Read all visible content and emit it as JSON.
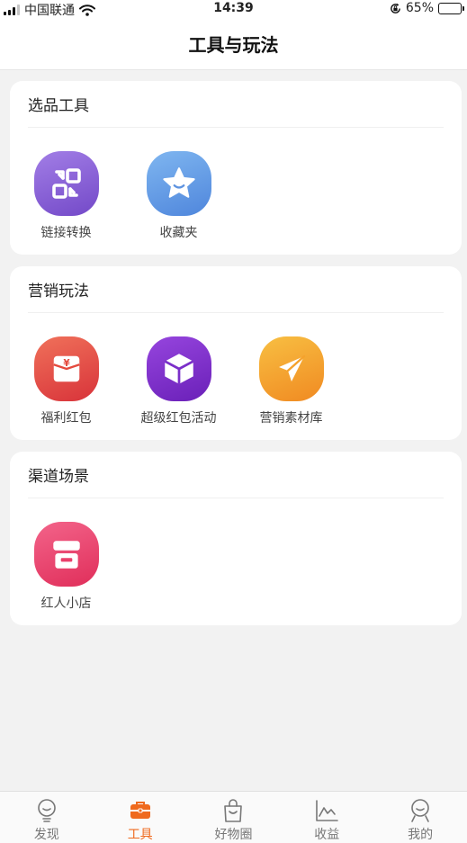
{
  "status_bar": {
    "carrier": "中国联通",
    "time": "14:39",
    "battery": "65%",
    "battery_level": 0.65
  },
  "nav": {
    "title": "工具与玩法"
  },
  "sections": [
    {
      "title": "选品工具",
      "items": [
        {
          "label": "链接转换",
          "icon": "link-convert-icon",
          "color": "#8a5fd6"
        },
        {
          "label": "收藏夹",
          "icon": "star-icon",
          "color": "#5e9be6"
        }
      ]
    },
    {
      "title": "营销玩法",
      "items": [
        {
          "label": "福利红包",
          "icon": "red-envelope-icon",
          "color": "#e44a3e"
        },
        {
          "label": "超级红包活动",
          "icon": "cube-icon",
          "color": "#7b2fc9"
        },
        {
          "label": "营销素材库",
          "icon": "paper-plane-icon",
          "color": "#f5a22c"
        }
      ]
    },
    {
      "title": "渠道场景",
      "items": [
        {
          "label": "红人小店",
          "icon": "shop-icon",
          "color": "#ea3f6b"
        }
      ]
    }
  ],
  "tabs": [
    {
      "label": "发现",
      "icon": "bulb-icon",
      "active": false
    },
    {
      "label": "工具",
      "icon": "toolbox-icon",
      "active": true
    },
    {
      "label": "好物圈",
      "icon": "shopping-bag-icon",
      "active": false
    },
    {
      "label": "收益",
      "icon": "earnings-chart-icon",
      "active": false
    },
    {
      "label": "我的",
      "icon": "profile-icon",
      "active": false
    }
  ],
  "colors": {
    "accent": "#ef6a1e"
  }
}
